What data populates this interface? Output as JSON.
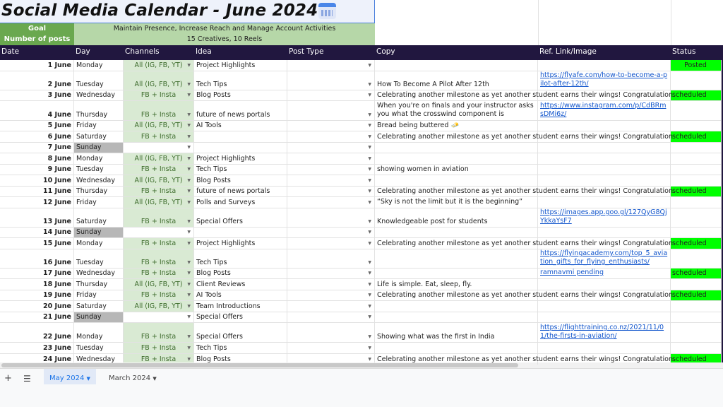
{
  "title": "Social Media Calendar - June 2024",
  "title_icon": "calendar-icon",
  "goal": {
    "label": "Goal",
    "value": "Maintain Presence, Increase Reach and Manage Account Activities"
  },
  "posts": {
    "label": "Number of posts",
    "value": "15 Creatives, 10 Reels"
  },
  "columns": [
    "Date",
    "Day",
    "Channels",
    "Idea",
    "Post Type",
    "Copy",
    "Ref. Link/Image",
    "Status"
  ],
  "rows": [
    {
      "date": "1 June",
      "day": "Monday",
      "channels": "All (IG, FB, YT)",
      "idea": "Project Highlights",
      "copy": "",
      "ref": "",
      "status": "Posted"
    },
    {
      "date": "2 June",
      "day": "Tuesday",
      "channels": "All (IG, FB, YT)",
      "idea": "Tech Tips",
      "copy": "How To Become A Pilot After 12th",
      "ref": "https://flyafe.com/how-to-become-a-pilot-after-12th/",
      "status": ""
    },
    {
      "date": "3 June",
      "day": "Wednesday",
      "channels": "FB + Insta",
      "idea": "Blog Posts",
      "copy": "Celebrating another milestone as yet another student earns their wings! Congratulation",
      "ref": "",
      "status": "scheduled"
    },
    {
      "date": "4 June",
      "day": "Thursday",
      "channels": "FB + Insta",
      "idea": "future of news portals",
      "copy": "When you're on finals and your instructor asks you what the crosswind component is",
      "ref": "https://www.instagram.com/p/CdBRmsDMi6z/",
      "status": ""
    },
    {
      "date": "5 June",
      "day": "Friday",
      "channels": "All (IG, FB, YT)",
      "idea": "AI Tools",
      "copy": "Bread being buttered 🧈",
      "ref": "",
      "status": ""
    },
    {
      "date": "6 June",
      "day": "Saturday",
      "channels": "FB + Insta",
      "idea": "",
      "copy": "Celebrating another milestone as yet another student earns their wings! Congratulation",
      "ref": "",
      "status": "scheduled"
    },
    {
      "date": "7 June",
      "day": "Sunday",
      "channels": "",
      "idea": "",
      "copy": "",
      "ref": "",
      "status": ""
    },
    {
      "date": "8 June",
      "day": "Monday",
      "channels": "All (IG, FB, YT)",
      "idea": "Project Highlights",
      "copy": "",
      "ref": "",
      "status": ""
    },
    {
      "date": "9 June",
      "day": "Tuesday",
      "channels": "FB + Insta",
      "idea": "Tech Tips",
      "copy": "showing women in aviation",
      "ref": "",
      "status": ""
    },
    {
      "date": "10 June",
      "day": "Wednesday",
      "channels": "All (IG, FB, YT)",
      "idea": "Blog Posts",
      "copy": "",
      "ref": "",
      "status": ""
    },
    {
      "date": "11 June",
      "day": "Thursday",
      "channels": "FB + Insta",
      "idea": "future of news portals",
      "copy": "Celebrating another milestone as yet another student earns their wings! Congratulation",
      "ref": "",
      "status": "scheduled"
    },
    {
      "date": "12 June",
      "day": "Friday",
      "channels": "All (IG, FB, YT)",
      "idea": "Polls and Surveys",
      "copy": "“Sky is not the limit but it is the beginning”",
      "ref": "",
      "status": ""
    },
    {
      "date": "13 June",
      "day": "Saturday",
      "channels": "FB + Insta",
      "idea": "Special Offers",
      "copy": "Knowledgeable post for students",
      "ref": "https://images.app.goo.gl/127QyG8QjYkkaYsF7",
      "status": ""
    },
    {
      "date": "14 June",
      "day": "Sunday",
      "channels": "",
      "idea": "",
      "copy": "",
      "ref": "",
      "status": ""
    },
    {
      "date": "15 June",
      "day": "Monday",
      "channels": "FB + Insta",
      "idea": "Project Highlights",
      "copy": "Celebrating another milestone as yet another student earns their wings! Congratulation",
      "ref": "",
      "status": "scheduled"
    },
    {
      "date": "16 June",
      "day": "Tuesday",
      "channels": "FB + Insta",
      "idea": "Tech Tips",
      "copy": "",
      "ref": "https://flyingacademy.com/top_5_aviation_gifts_for_flying_enthusiasts/",
      "status": ""
    },
    {
      "date": "17 June",
      "day": "Wednesday",
      "channels": "FB + Insta",
      "idea": "Blog Posts",
      "copy": "",
      "ref": "ramnavmi pending",
      "status": "scheduled"
    },
    {
      "date": "18 June",
      "day": "Thursday",
      "channels": "All (IG, FB, YT)",
      "idea": "Client Reviews",
      "copy": "Life is simple. Eat, sleep, fly.",
      "ref": "",
      "status": ""
    },
    {
      "date": "19 June",
      "day": "Friday",
      "channels": "FB + Insta",
      "idea": "AI Tools",
      "copy": "Celebrating another milestone as yet another student earns their wings! Congratulation",
      "ref": "",
      "status": "scheduled"
    },
    {
      "date": "20 June",
      "day": "Saturday",
      "channels": "All (IG, FB, YT)",
      "idea": "Team Introductions",
      "copy": "",
      "ref": "",
      "status": ""
    },
    {
      "date": "21 June",
      "day": "Sunday",
      "channels": "",
      "idea": "Special Offers",
      "copy": "",
      "ref": "",
      "status": ""
    },
    {
      "date": "22 June",
      "day": "Monday",
      "channels": "FB + Insta",
      "idea": "Special Offers",
      "copy": "Showing what was the first in India",
      "ref": "https://flighttraining.co.nz/2021/11/01/the-firsts-in-aviation/",
      "status": ""
    },
    {
      "date": "23 June",
      "day": "Tuesday",
      "channels": "FB + Insta",
      "idea": "Tech Tips",
      "copy": "",
      "ref": "",
      "status": ""
    },
    {
      "date": "24 June",
      "day": "Wednesday",
      "channels": "FB + Insta",
      "idea": "Blog Posts",
      "copy": "Celebrating another milestone as yet another student earns their wings! Congratulation",
      "ref": "",
      "status": "scheduled"
    }
  ],
  "sheet_tabs": {
    "add": "+",
    "menu": "☰",
    "tabs": [
      "May 2024",
      "March 2024"
    ],
    "active": "May 2024"
  },
  "colors": {
    "header": "#21173f",
    "channels": "#d9ead3",
    "status_green": "#00ff00",
    "sunday": "#b7b7b7",
    "goal_label": "#6aa84f",
    "goal_value": "#b6d7a8"
  }
}
